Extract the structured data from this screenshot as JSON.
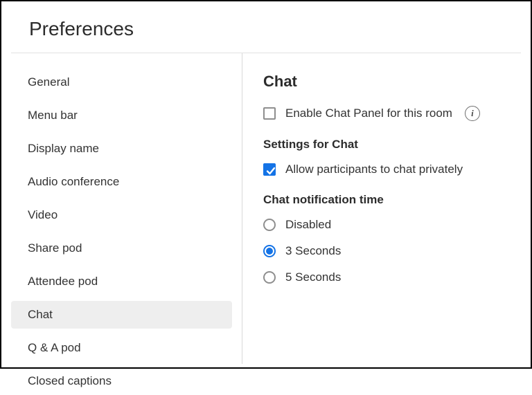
{
  "title": "Preferences",
  "sidebar": {
    "items": [
      {
        "label": "General",
        "selected": false
      },
      {
        "label": "Menu bar",
        "selected": false
      },
      {
        "label": "Display name",
        "selected": false
      },
      {
        "label": "Audio conference",
        "selected": false
      },
      {
        "label": "Video",
        "selected": false
      },
      {
        "label": "Share pod",
        "selected": false
      },
      {
        "label": "Attendee pod",
        "selected": false
      },
      {
        "label": "Chat",
        "selected": true
      },
      {
        "label": "Q & A pod",
        "selected": false
      },
      {
        "label": "Closed captions",
        "selected": false
      }
    ]
  },
  "content": {
    "heading": "Chat",
    "enable_panel": {
      "label": "Enable Chat Panel for this room",
      "checked": false
    },
    "settings_heading": "Settings for Chat",
    "allow_private": {
      "label": "Allow participants to chat privately",
      "checked": true
    },
    "notif_heading": "Chat notification time",
    "notif_options": [
      {
        "label": "Disabled",
        "selected": false
      },
      {
        "label": "3 Seconds",
        "selected": true
      },
      {
        "label": "5 Seconds",
        "selected": false
      }
    ]
  },
  "colors": {
    "accent": "#1473e6"
  }
}
